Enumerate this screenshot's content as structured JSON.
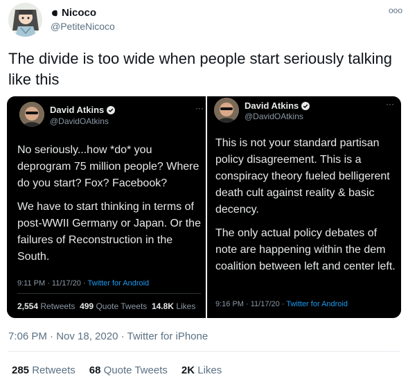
{
  "author": {
    "name": "Nicoco",
    "handle": "@PetiteNicoco",
    "avatar_icon": "cartoon-avatar-icon",
    "badge_icon": "profile-badge-icon"
  },
  "more_icon": "ooo",
  "tweet_text": "The divide is too wide when people start seriously talking like this",
  "quoted": [
    {
      "name": "David Atkins",
      "handle": "@DavidOAtkins",
      "paragraphs": [
        "No seriously...how *do* you deprogram 75 million people? Where do you start? Fox? Facebook?",
        "We have to start thinking in terms of post-WWII Germany or Japan. Or the failures of Reconstruction in the South."
      ],
      "time": "9:11 PM · 11/17/20 · ",
      "source": "Twitter for Android",
      "retweets": "2,554",
      "retweets_label": "Retweets",
      "quotes": "499",
      "quotes_label": "Quote Tweets",
      "likes": "14.8K",
      "likes_label": "Likes"
    },
    {
      "name": "David Atkins",
      "handle": "@DavidOAtkins",
      "paragraphs": [
        "This is not your standard partisan policy disagreement. This is a conspiracy theory fueled belligerent death cult against reality & basic decency.",
        "The only actual policy debates of note are happening within the dem coalition between left and center left."
      ],
      "time": "9:16 PM · 11/17/20 · ",
      "source": "Twitter for Android"
    }
  ],
  "timestamp": "7:06 PM · Nov 18, 2020 · Twitter for iPhone",
  "stats": {
    "retweets": "285",
    "retweets_label": "Retweets",
    "quotes": "68",
    "quotes_label": "Quote Tweets",
    "likes": "2K",
    "likes_label": "Likes"
  },
  "colors": {
    "accent": "#1d9bf0",
    "secondary_text": "#5b7083"
  }
}
